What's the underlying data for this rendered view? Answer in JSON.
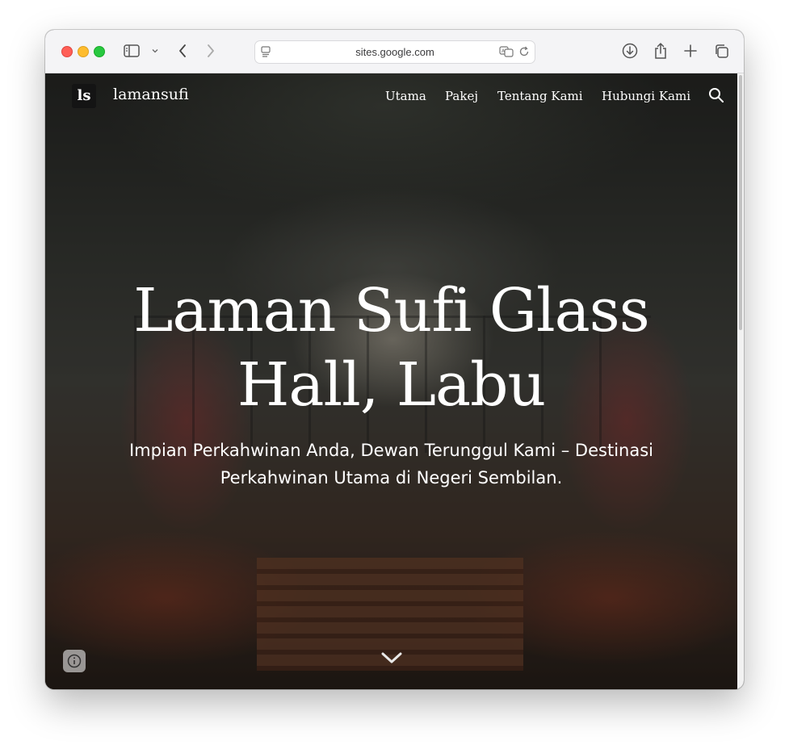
{
  "browser": {
    "url": "sites.google.com",
    "icons": {
      "sidebar": "sidebar-icon",
      "back": "chevron-left-icon",
      "forward": "chevron-right-icon",
      "downloads": "download-icon",
      "share": "share-icon",
      "new_tab": "plus-icon",
      "tabs": "tabs-icon"
    }
  },
  "site": {
    "logo_text": "ls",
    "name": "lamansufi",
    "nav": [
      {
        "label": "Utama"
      },
      {
        "label": "Pakej"
      },
      {
        "label": "Tentang Kami"
      },
      {
        "label": "Hubungi Kami"
      }
    ]
  },
  "hero": {
    "title": "Laman Sufi Glass Hall, Labu",
    "subtitle": "Impian Perkahwinan Anda, Dewan Terunggul Kami – Destinasi Perkahwinan Utama di Negeri Sembilan."
  },
  "colors": {
    "text": "#ffffff",
    "traffic_red": "#ff5f57",
    "traffic_yellow": "#febc2e",
    "traffic_green": "#28c840"
  }
}
